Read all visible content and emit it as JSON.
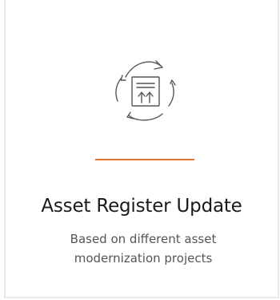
{
  "card": {
    "icon": "asset-cycle-upload-icon",
    "title": "Asset Register Update",
    "description": "Based on different asset modernization projects"
  },
  "colors": {
    "accent": "#e8782f",
    "icon_stroke": "#555555",
    "border": "#ebebeb"
  }
}
